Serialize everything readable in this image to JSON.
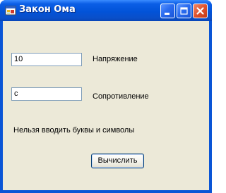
{
  "window": {
    "title": "Закон Ома"
  },
  "form": {
    "voltage_value": "10",
    "voltage_label": "Напряжение",
    "resistance_value": "с",
    "resistance_label": "Сопротивление",
    "error_message": "Нельзя вводить буквы и символы",
    "calculate_label": "Вычислить"
  },
  "icons": {
    "app": "app-form-icon",
    "minimize": "minimize-icon",
    "maximize": "maximize-icon",
    "close": "close-icon"
  },
  "colors": {
    "titlebar": "#0253d8",
    "client_background": "#ece9d8",
    "close_button": "#e0532e"
  }
}
